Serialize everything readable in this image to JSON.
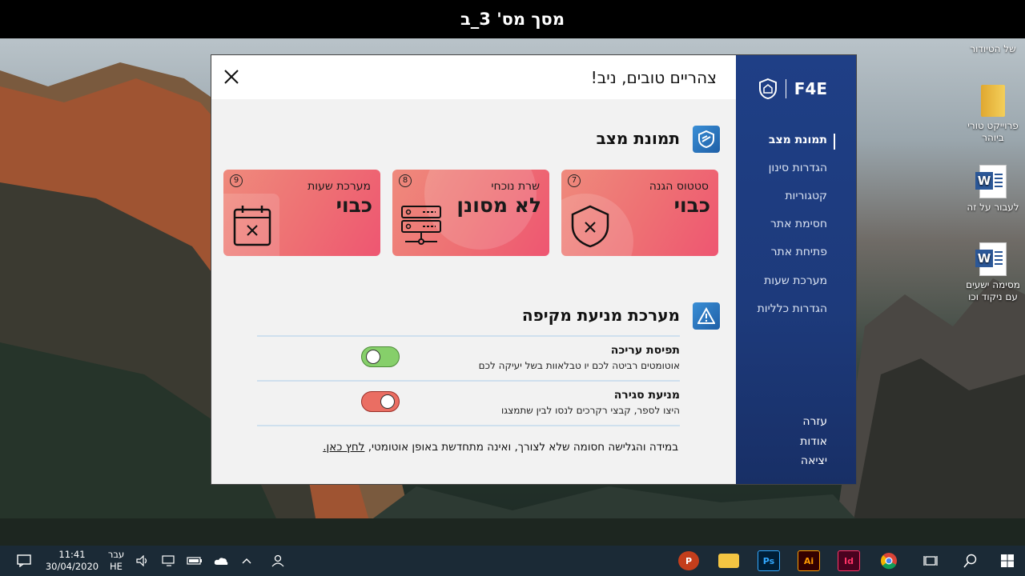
{
  "caption": "מסך מס' 3_ב",
  "desktop_icons": [
    {
      "label": "של הטיודור",
      "type": "text"
    },
    {
      "label": "פרוייקט טורי ביוהר",
      "type": "folder"
    },
    {
      "label": "לעבור על זה",
      "type": "word"
    },
    {
      "label": "מסימה ישעים עם ניקוד וכו",
      "type": "word"
    }
  ],
  "app": {
    "greeting": "צהריים טובים, ניב!",
    "brand": "F4E",
    "status_section": {
      "title": "תמונת מצב",
      "cards": [
        {
          "num": "7",
          "label": "סטטוס הגנה",
          "value": "כבוי",
          "icon": "shield-x-icon"
        },
        {
          "num": "8",
          "label": "שרת נוכחי",
          "value": "לא מסונן",
          "icon": "server-icon"
        },
        {
          "num": "9",
          "label": "מערכת שעות",
          "value": "כבוי",
          "icon": "calendar-x-icon"
        }
      ]
    },
    "prevention_section": {
      "title": "מערכת מניעת מקיפה",
      "toggles": [
        {
          "title": "תפיסת עריכה",
          "desc": "אוטומטים רביטה לכם יו טבלאוות בשל יעיקה לכם",
          "state": "on",
          "color": "#86cf6a"
        },
        {
          "title": "מניעת סגירה",
          "desc": "היצו לספר, קבצי רקרכים לנסו לבין שתמצגו",
          "state": "off",
          "color": "#ea6e63"
        }
      ]
    },
    "footer_note": {
      "text": "במידה והגלישה חסומה שלא לצורך, ואינה מתחדשת באופן אוטומטי,",
      "link": "לחץ כאן."
    },
    "nav": [
      {
        "label": "תמונת מצב",
        "active": true
      },
      {
        "label": "הגדרות סינון",
        "active": false
      },
      {
        "label": "קטגוריות",
        "active": false
      },
      {
        "label": "חסימת אתר",
        "active": false
      },
      {
        "label": "פתיחת אתר",
        "active": false
      },
      {
        "label": "מערכת שעות",
        "active": false
      },
      {
        "label": "הגדרות כלליות",
        "active": false
      }
    ],
    "nav_footer": [
      "עזרה",
      "אודות",
      "יציאה"
    ]
  },
  "taskbar": {
    "time": "11:41",
    "date": "30/04/2020",
    "lang_top": "עבר",
    "lang": "HE",
    "apps": [
      {
        "name": "powerpoint",
        "label": "P",
        "color": "#c43e1c"
      },
      {
        "name": "file-explorer",
        "label": "",
        "color": "#f4c542"
      },
      {
        "name": "photoshop",
        "label": "Ps",
        "color": "#001e36"
      },
      {
        "name": "illustrator",
        "label": "Ai",
        "color": "#330000"
      },
      {
        "name": "indesign",
        "label": "Id",
        "color": "#49021f"
      },
      {
        "name": "chrome",
        "label": "",
        "color": "#e8453c"
      }
    ]
  }
}
